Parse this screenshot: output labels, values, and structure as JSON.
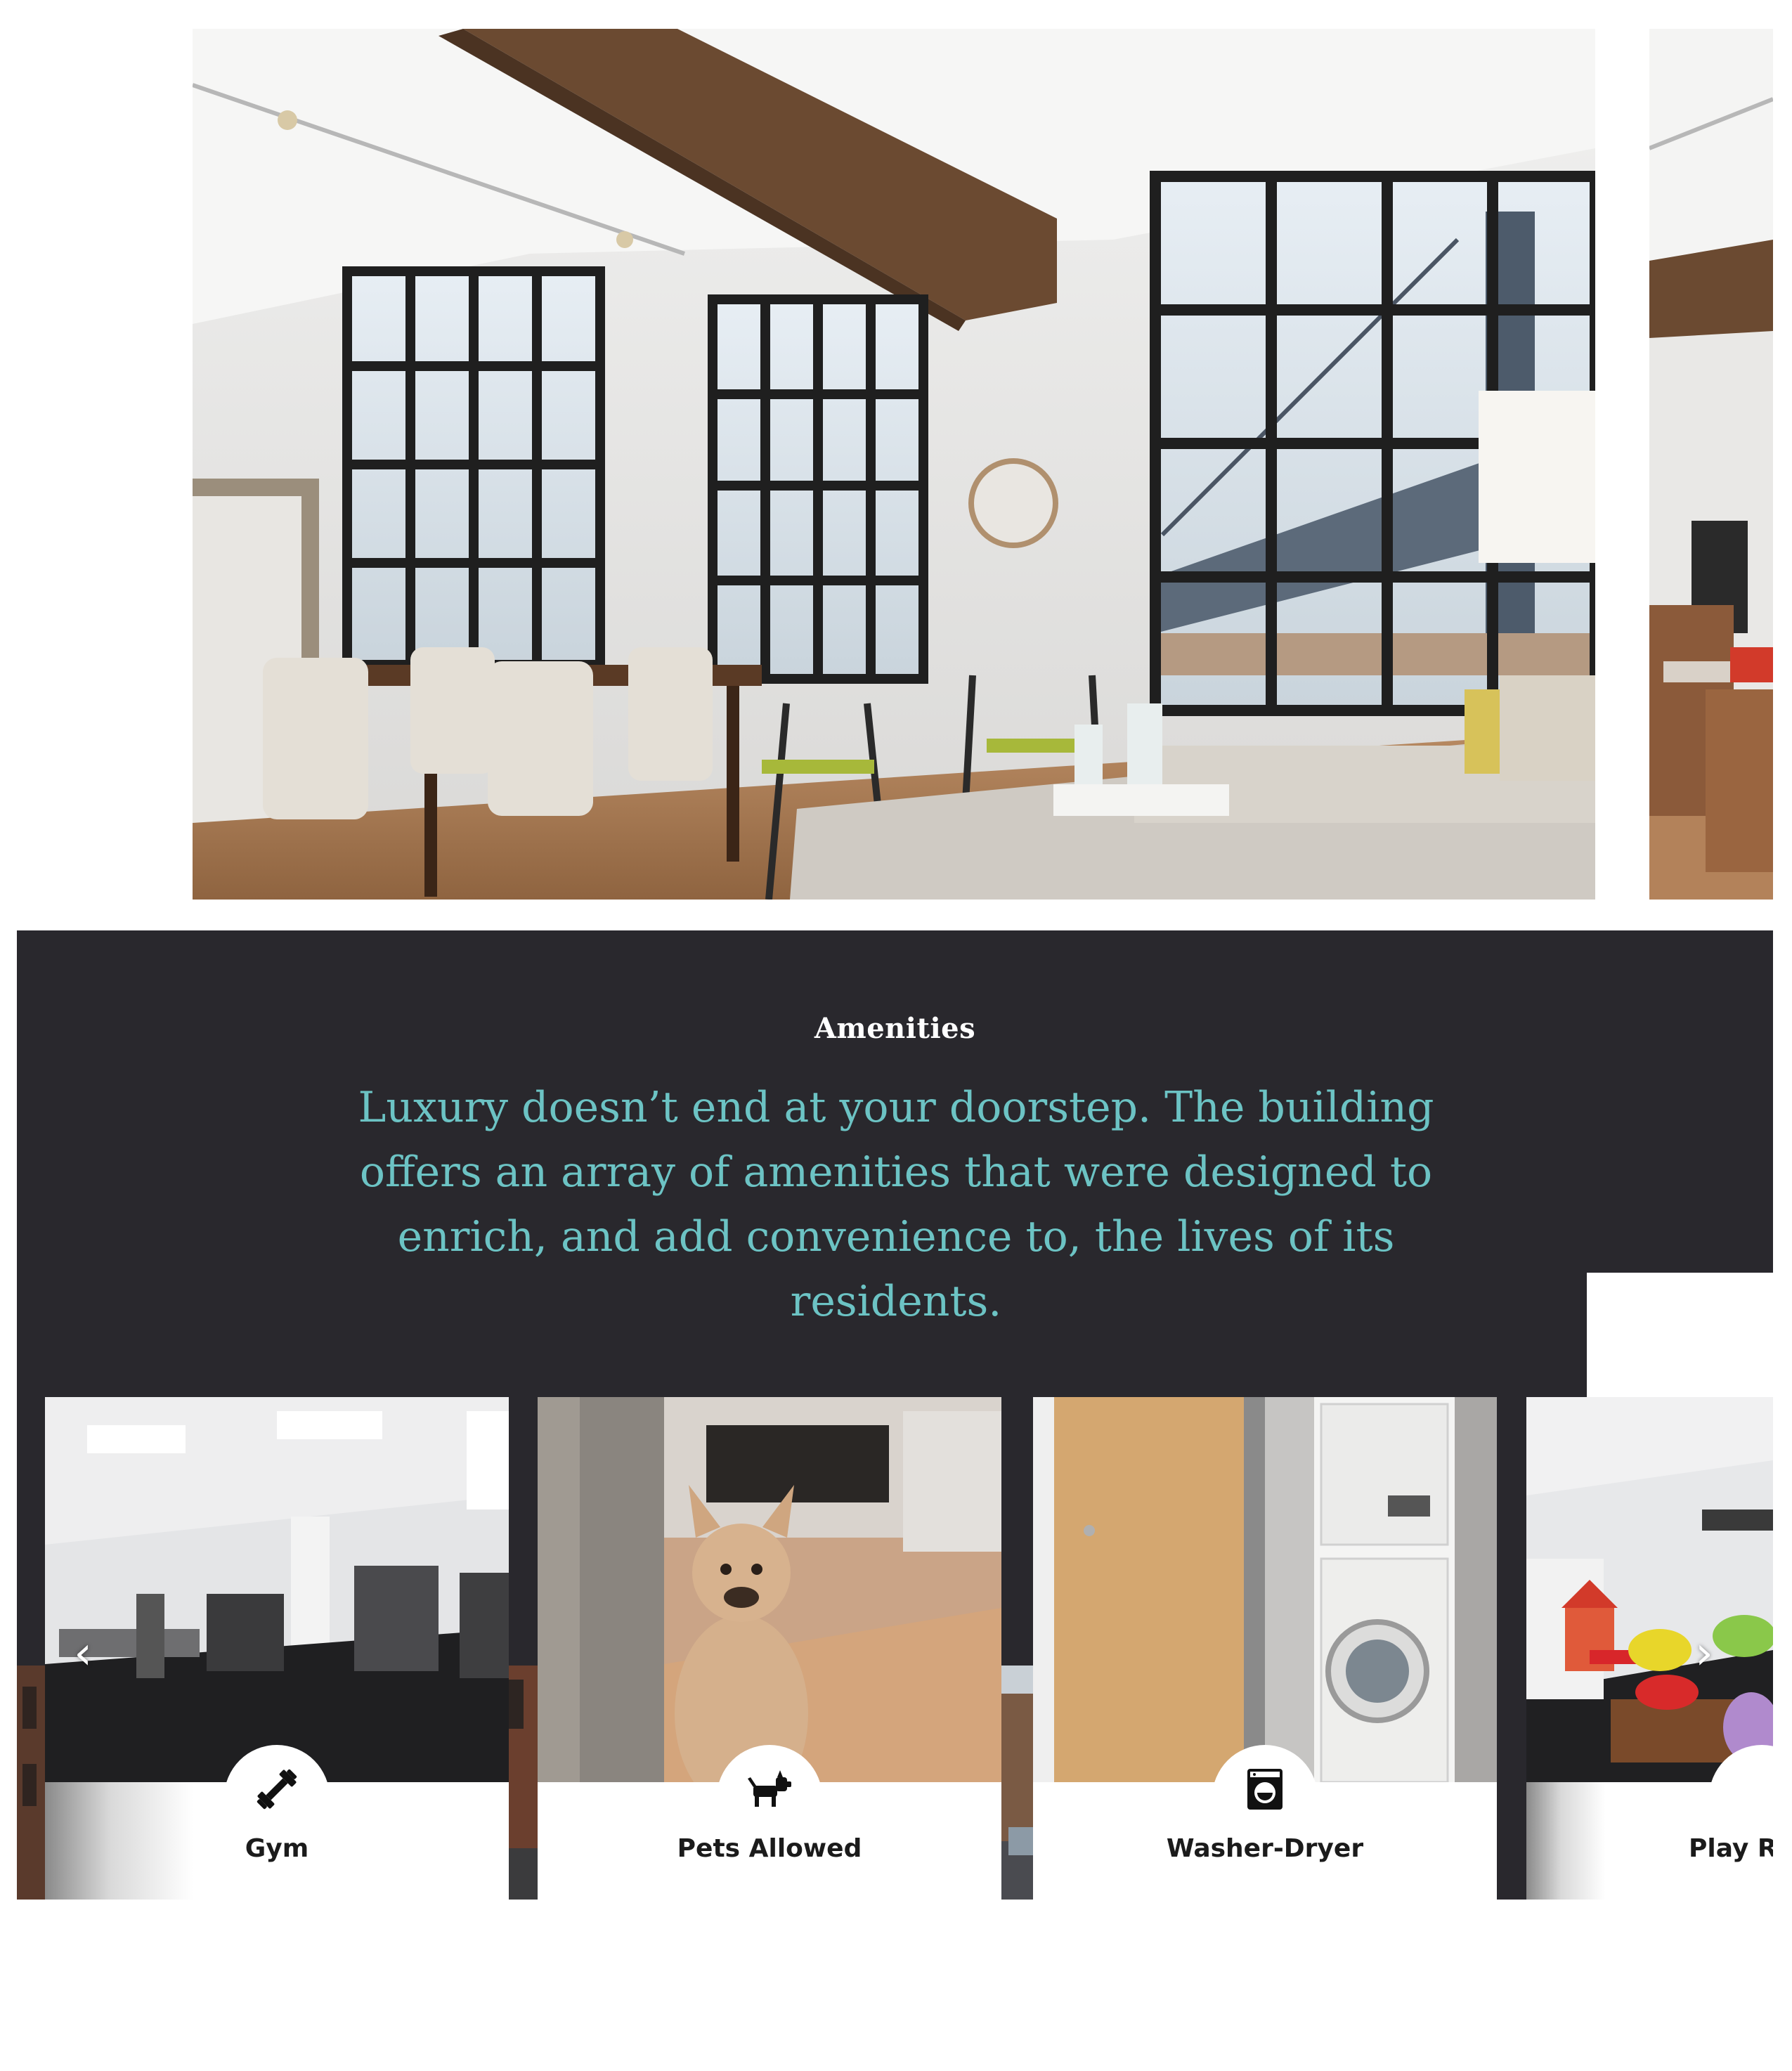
{
  "amenities": {
    "title": "Amenities",
    "intro": "Luxury doesn’t end at your doorstep. The building offers an array of amenities that were designed to enrich, and add convenience to, the lives of its residents.",
    "cards": [
      {
        "label": "Gym",
        "icon": "dumbbell-icon"
      },
      {
        "label": "Pets Allowed",
        "icon": "dog-icon"
      },
      {
        "label": "Washer-Dryer",
        "icon": "washing-machine-icon"
      },
      {
        "label": "Play Ro",
        "icon": "play-room-icon"
      }
    ],
    "prev_arrow": "‹",
    "next_arrow": "›"
  },
  "colors": {
    "band_background": "#29282d",
    "intro_text": "#6cc3c4",
    "title_text": "#ffffff"
  }
}
